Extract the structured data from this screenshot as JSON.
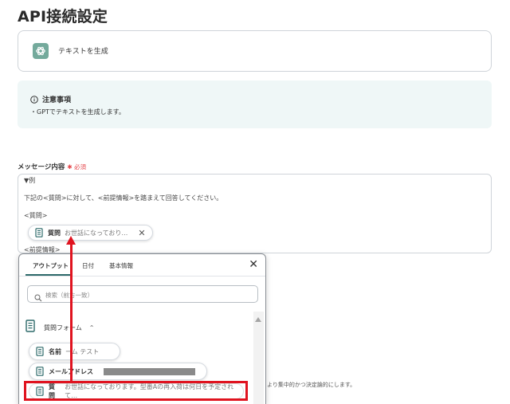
{
  "page": {
    "title": "API接続設定"
  },
  "app": {
    "name": "テキストを生成"
  },
  "notice": {
    "title": "注意事項",
    "body": "・GPTでテキストを生成します。"
  },
  "message_field": {
    "label": "メッセージ内容",
    "required": "必須",
    "lines": {
      "example": "▼例",
      "instruction": "下記の<質問>に対して、<前提情報>を踏まえて回答してください。",
      "question_tag": "<質問>",
      "premise_tag": "<前提情報>"
    },
    "chip": {
      "name": "質問",
      "value": "お世話になっており…"
    }
  },
  "dropdown": {
    "tabs": [
      "アウトプット",
      "日付",
      "基本情報"
    ],
    "search_placeholder": "検索（前方一致）",
    "group": {
      "title": "質問フォーム"
    },
    "items": [
      {
        "name": "名前",
        "value": "ーム テスト"
      },
      {
        "name": "メールアドレス",
        "value": ""
      },
      {
        "name": "質問",
        "value": "お世話になっております。型番Aの再入荷は何日を予定されて…"
      }
    ]
  },
  "background_note": "より集中的かつ決定論的にします。",
  "colors": {
    "highlight": "#e0131f",
    "accent": "#2d6a6a",
    "notice_bg": "#eff7f7",
    "openai_green": "#74aa9c"
  }
}
